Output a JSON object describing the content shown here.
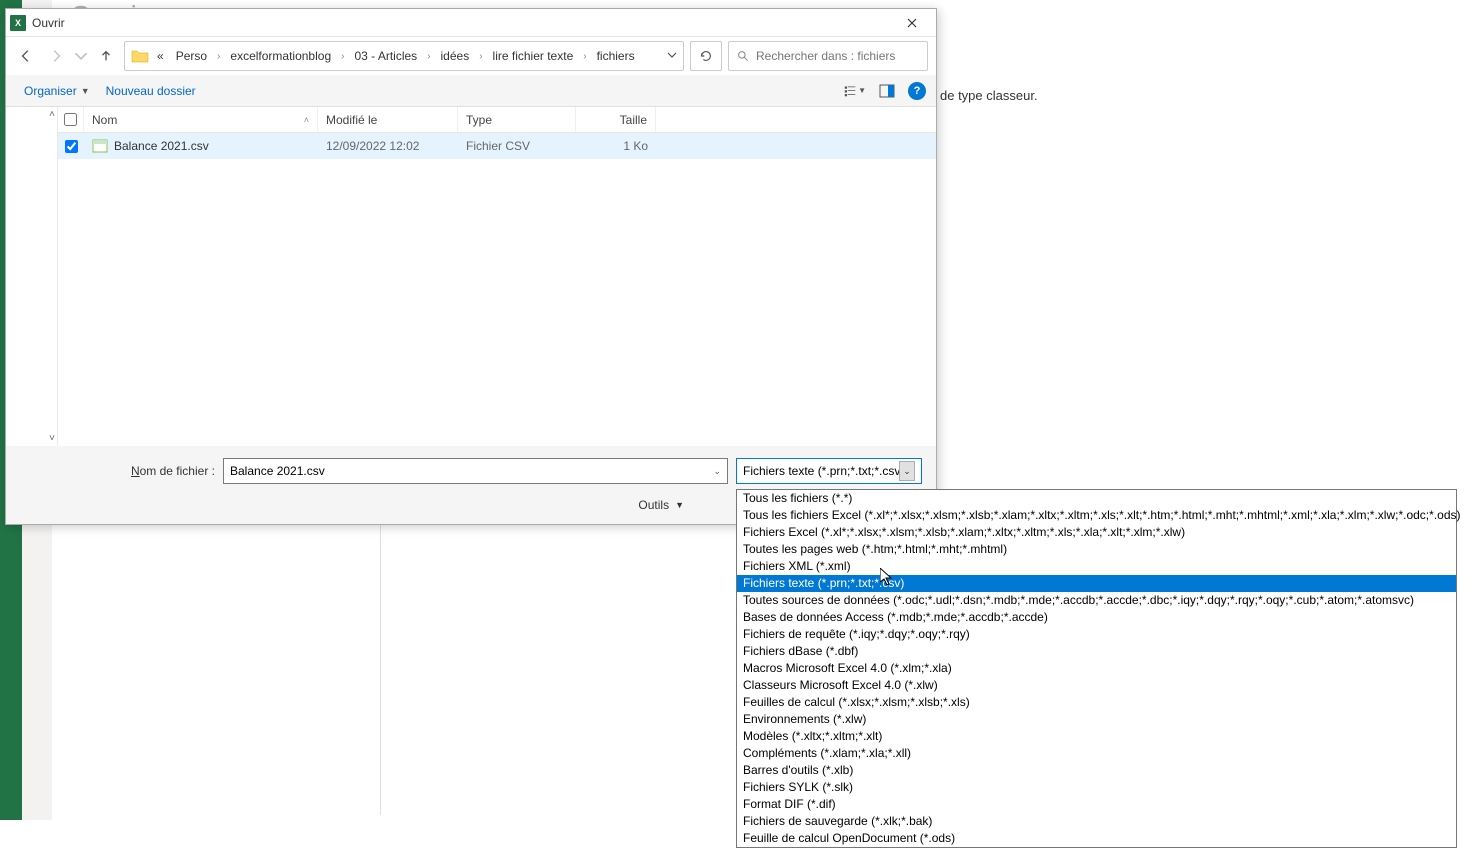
{
  "bg": {
    "title_faded": "Ouvrir",
    "right_text": "de type classeur."
  },
  "dialog": {
    "title": "Ouvrir",
    "breadcrumb": {
      "prefix": "«",
      "items": [
        "Perso",
        "excelformationblog",
        "03 - Articles",
        "idées",
        "lire fichier texte",
        "fichiers"
      ]
    },
    "search_placeholder": "Rechercher dans : fichiers",
    "toolbar": {
      "organize": "Organiser",
      "new_folder": "Nouveau dossier"
    },
    "columns": {
      "name": "Nom",
      "modified": "Modifié le",
      "type": "Type",
      "size": "Taille"
    },
    "files": [
      {
        "name": "Balance 2021.csv",
        "modified": "12/09/2022 12:02",
        "type": "Fichier CSV",
        "size": "1 Ko",
        "checked": true
      }
    ],
    "filename_label_pre": "N",
    "filename_label_post": "om de fichier :",
    "filename_value": "Balance 2021.csv",
    "filetype_value": "Fichiers texte (*.prn;*.txt;*.csv)",
    "tools_label": "Outils"
  },
  "dropdown": {
    "options": [
      "Tous les fichiers (*.*)",
      "Tous les fichiers Excel (*.xl*;*.xlsx;*.xlsm;*.xlsb;*.xlam;*.xltx;*.xltm;*.xls;*.xlt;*.htm;*.html;*.mht;*.mhtml;*.xml;*.xla;*.xlm;*.xlw;*.odc;*.ods)",
      "Fichiers Excel (*.xl*;*.xlsx;*.xlsm;*.xlsb;*.xlam;*.xltx;*.xltm;*.xls;*.xla;*.xlt;*.xlm;*.xlw)",
      "Toutes les pages web (*.htm;*.html;*.mht;*.mhtml)",
      "Fichiers XML (*.xml)",
      "Fichiers texte (*.prn;*.txt;*.csv)",
      "Toutes sources de données (*.odc;*.udl;*.dsn;*.mdb;*.mde;*.accdb;*.accde;*.dbc;*.iqy;*.dqy;*.rqy;*.oqy;*.cub;*.atom;*.atomsvc)",
      "Bases de données Access (*.mdb;*.mde;*.accdb;*.accde)",
      "Fichiers de requête (*.iqy;*.dqy;*.oqy;*.rqy)",
      "Fichiers dBase (*.dbf)",
      "Macros Microsoft Excel 4.0 (*.xlm;*.xla)",
      "Classeurs Microsoft Excel 4.0 (*.xlw)",
      "Feuilles de calcul (*.xlsx;*.xlsm;*.xlsb;*.xls)",
      "Environnements (*.xlw)",
      "Modèles (*.xltx;*.xltm;*.xlt)",
      "Compléments (*.xlam;*.xla;*.xll)",
      "Barres d'outils (*.xlb)",
      "Fichiers SYLK (*.slk)",
      "Format DIF (*.dif)",
      "Fichiers de sauvegarde (*.xlk;*.bak)",
      "Feuille de calcul OpenDocument (*.ods)"
    ],
    "selected_index": 5
  }
}
